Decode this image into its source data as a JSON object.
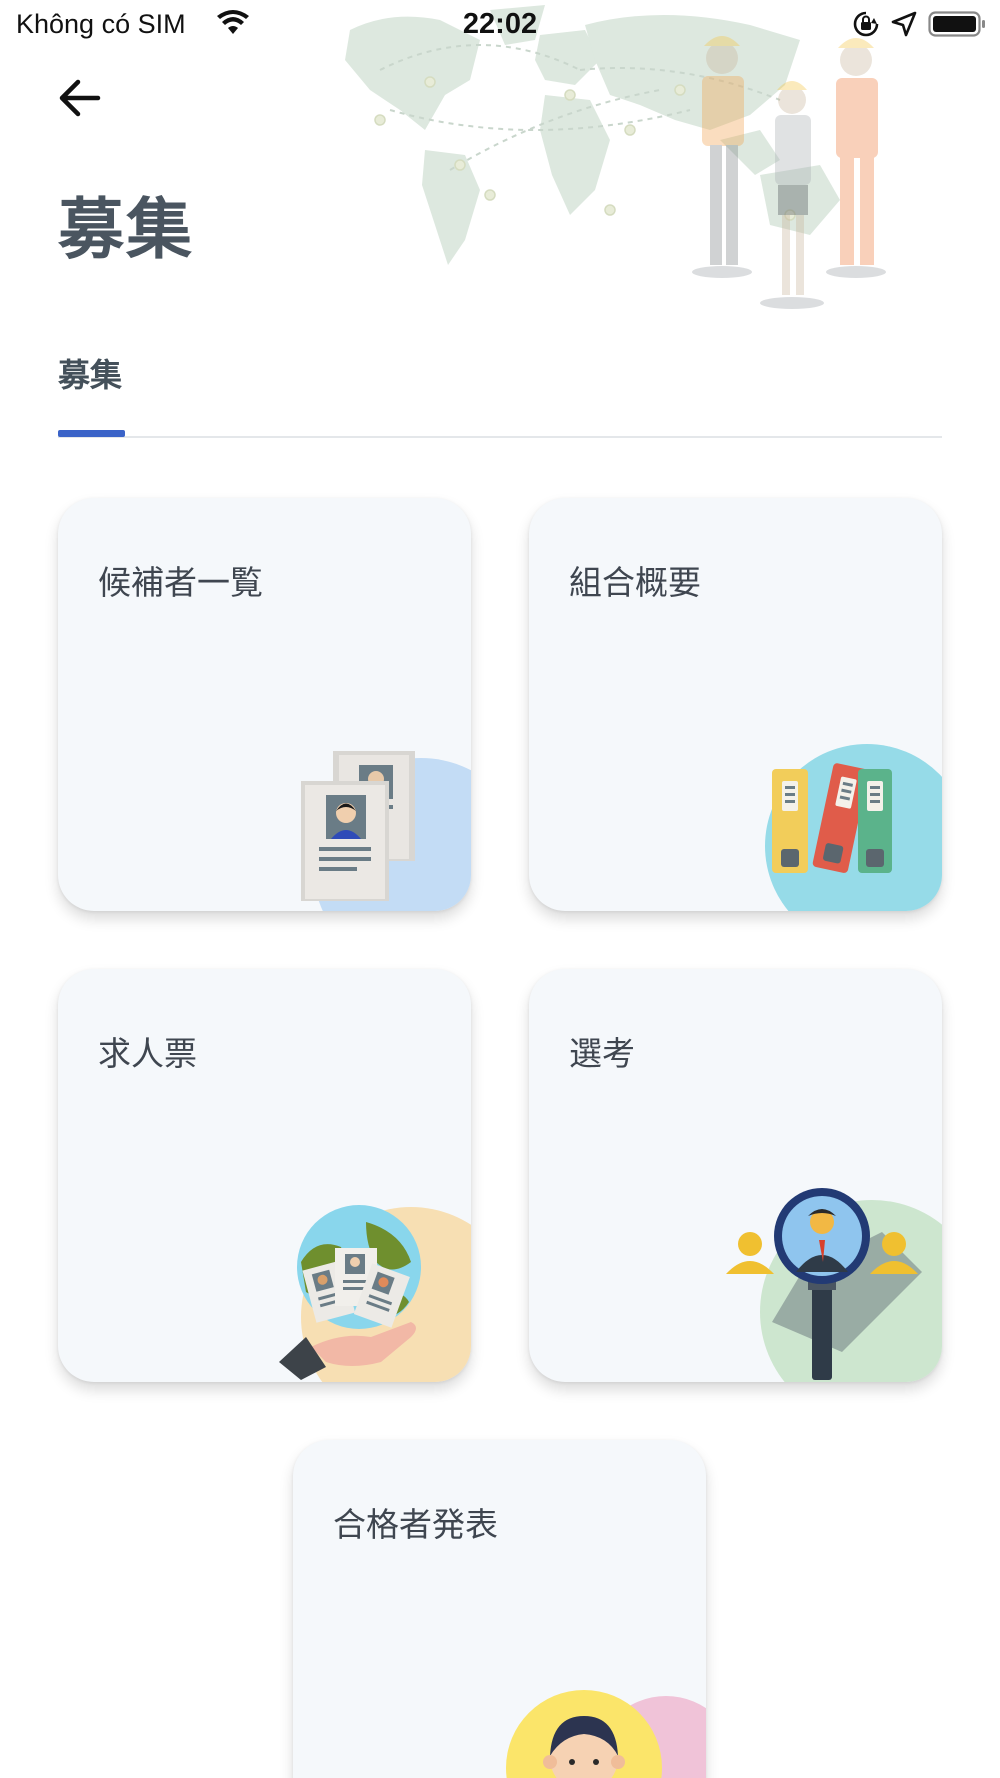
{
  "status_bar": {
    "carrier": "Không có SIM",
    "time": "22:02",
    "icons": [
      "wifi-icon",
      "orientation-lock-icon",
      "location-arrow-icon",
      "battery-icon"
    ]
  },
  "header": {
    "back_icon": "arrow-left-icon",
    "title": "募集"
  },
  "tabs": [
    {
      "label": "募集",
      "active": true
    }
  ],
  "colors": {
    "accent": "#3a63c8",
    "title_text": "#4a5560",
    "card_bg": "#f5f8fb"
  },
  "cards": [
    {
      "label": "候補者一覧",
      "icon": "candidate-list-icon",
      "circle_color": "#c3dcf5"
    },
    {
      "label": "組合概要",
      "icon": "union-overview-binders-icon",
      "circle_color": "#96dbe8"
    },
    {
      "label": "求人票",
      "icon": "job-posting-icon",
      "circle_color": "#f7dfb3"
    },
    {
      "label": "選考",
      "icon": "selection-magnifier-icon",
      "circle_color": "#cde6cf"
    },
    {
      "label": "合格者発表",
      "icon": "pass-announcement-icon",
      "circle_color": "#f0c3d8"
    }
  ]
}
